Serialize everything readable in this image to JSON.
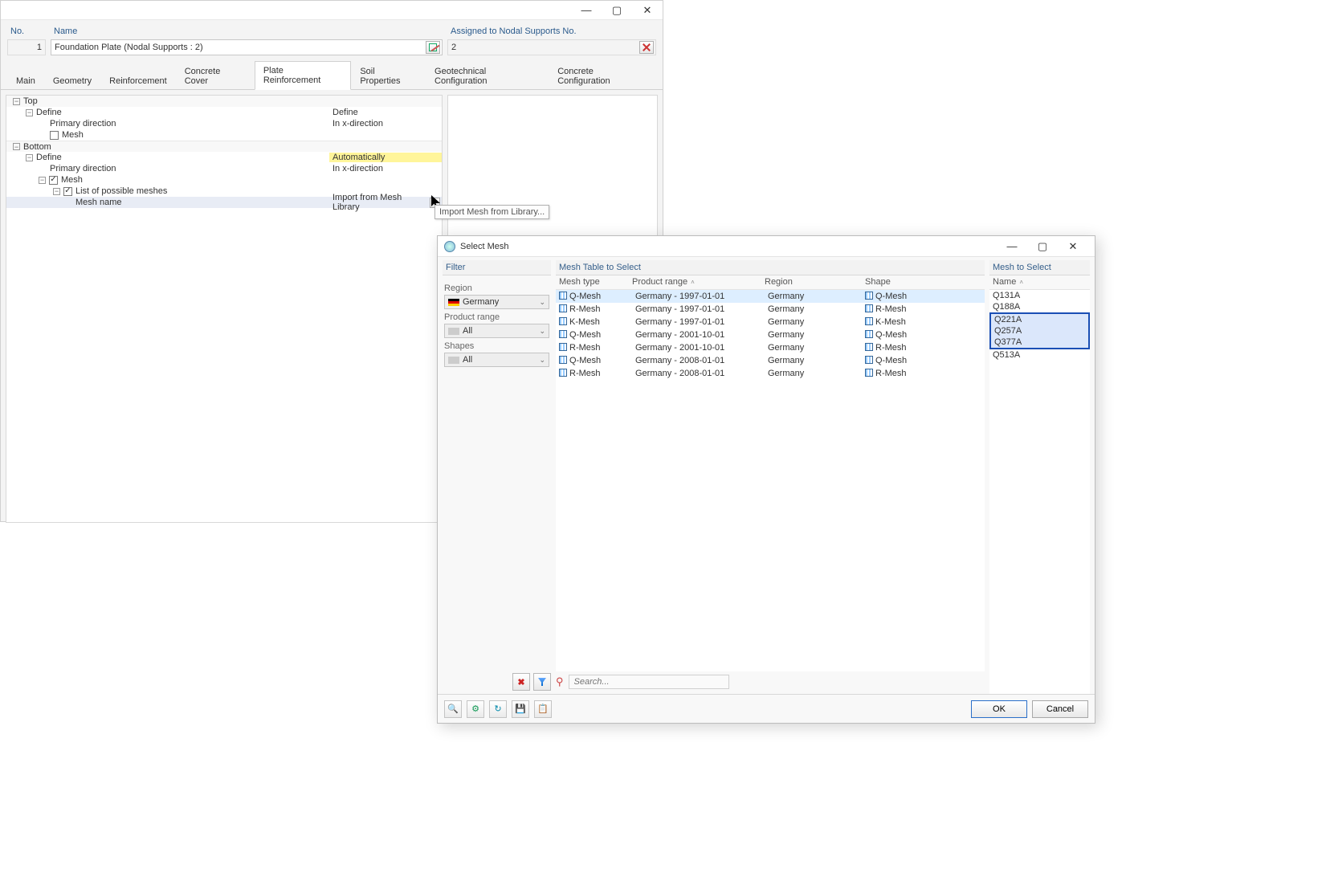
{
  "window": {
    "no_label": "No.",
    "no_value": "1",
    "name_label": "Name",
    "name_value": "Foundation Plate (Nodal Supports : 2)",
    "assigned_label": "Assigned to Nodal Supports No.",
    "assigned_value": "2"
  },
  "tabs": [
    "Main",
    "Geometry",
    "Reinforcement",
    "Concrete Cover",
    "Plate Reinforcement",
    "Soil Properties",
    "Geotechnical Configuration",
    "Concrete Configuration"
  ],
  "active_tab": 4,
  "tree": {
    "top_label": "Top",
    "bottom_label": "Bottom",
    "define": "Define",
    "primary_dir": "Primary direction",
    "mesh": "Mesh",
    "list_meshes": "List of possible meshes",
    "mesh_name": "Mesh name",
    "val_define_top": "Define",
    "val_in_x": "In x-direction",
    "val_auto": "Automatically",
    "val_import": "Import from Mesh Library"
  },
  "tooltip": "Import Mesh from Library...",
  "dialog": {
    "title": "Select Mesh",
    "filter_hdr": "Filter",
    "table_hdr": "Mesh Table to Select",
    "select_hdr": "Mesh to Select",
    "region_lbl": "Region",
    "region_val": "Germany",
    "range_lbl": "Product range",
    "range_val": "All",
    "shapes_lbl": "Shapes",
    "shapes_val": "All",
    "cols": {
      "type": "Mesh type",
      "range": "Product range",
      "region": "Region",
      "shape": "Shape",
      "name": "Name"
    },
    "rows": [
      {
        "type": "Q-Mesh",
        "range": "Germany - 1997-01-01",
        "region": "Germany",
        "shape": "Q-Mesh",
        "active": true
      },
      {
        "type": "R-Mesh",
        "range": "Germany - 1997-01-01",
        "region": "Germany",
        "shape": "R-Mesh"
      },
      {
        "type": "K-Mesh",
        "range": "Germany - 1997-01-01",
        "region": "Germany",
        "shape": "K-Mesh"
      },
      {
        "type": "Q-Mesh",
        "range": "Germany - 2001-10-01",
        "region": "Germany",
        "shape": "Q-Mesh"
      },
      {
        "type": "R-Mesh",
        "range": "Germany - 2001-10-01",
        "region": "Germany",
        "shape": "R-Mesh"
      },
      {
        "type": "Q-Mesh",
        "range": "Germany - 2008-01-01",
        "region": "Germany",
        "shape": "Q-Mesh"
      },
      {
        "type": "R-Mesh",
        "range": "Germany - 2008-01-01",
        "region": "Germany",
        "shape": "R-Mesh"
      }
    ],
    "names": [
      {
        "n": "Q131A"
      },
      {
        "n": "Q188A"
      },
      {
        "n": "Q221A",
        "hl": true
      },
      {
        "n": "Q257A",
        "hl": true
      },
      {
        "n": "Q377A",
        "hl": true
      },
      {
        "n": "Q513A"
      }
    ],
    "search_placeholder": "Search...",
    "ok": "OK",
    "cancel": "Cancel"
  }
}
